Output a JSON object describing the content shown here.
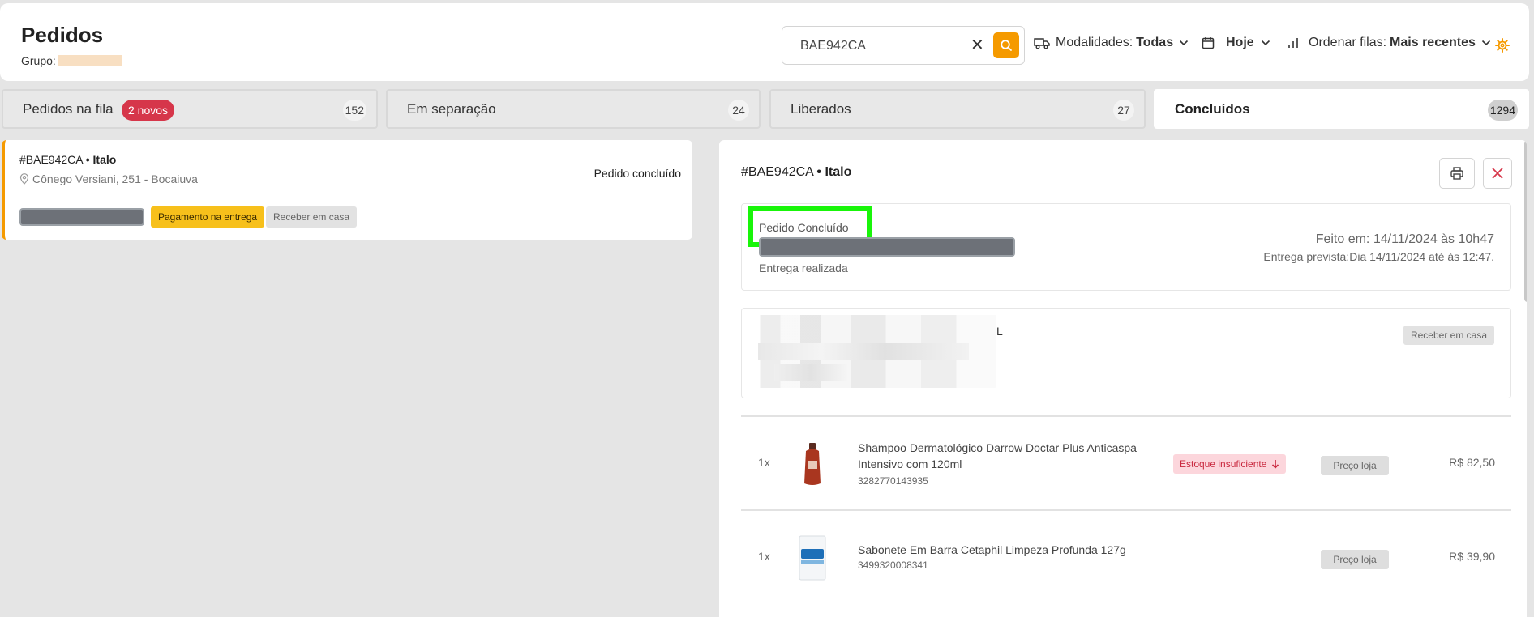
{
  "header": {
    "title": "Pedidos",
    "group_label": "Grupo:",
    "search": {
      "value": "BAE942CA",
      "placeholder": ""
    },
    "filters": {
      "modalidades_label": "Modalidades:",
      "modalidades_value": "Todas",
      "date_value": "Hoje",
      "ordenar_label": "Ordenar filas:",
      "ordenar_value": "Mais recentes"
    }
  },
  "tabs": [
    {
      "label": "Pedidos na fila",
      "badge": "2 novos",
      "count": "152",
      "active": false
    },
    {
      "label": "Em separação",
      "count": "24",
      "active": false
    },
    {
      "label": "Liberados",
      "count": "27",
      "active": false
    },
    {
      "label": "Concluídos",
      "count": "1294",
      "active": true
    }
  ],
  "order_card": {
    "id": "#BAE942CA",
    "customer": "Italo",
    "address": "Cônego Versiani, 251 - Bocaiuva",
    "status": "Pedido concluído",
    "chips": {
      "payment": "Pagamento na entrega",
      "delivery": "Receber em casa"
    }
  },
  "detail": {
    "id": "#BAE942CA",
    "customer": "Italo",
    "status_label": "Pedido Concluído",
    "status_sub": "Entrega realizada",
    "made_at": "Feito em: 14/11/2024 às 10h47",
    "expected": "Entrega prevista:Dia 14/11/2024 até às 12:47.",
    "customer_char": "L",
    "delivery_chip": "Receber em casa",
    "products": [
      {
        "qty": "1x",
        "name": "Shampoo Dermatológico Darrow Doctar Plus Anticaspa Intensivo com 120ml",
        "code": "3282770143935",
        "stock": "Estoque insuficiente",
        "price_tag": "Preço loja",
        "price": "R$ 82,50"
      },
      {
        "qty": "1x",
        "name": "Sabonete Em Barra Cetaphil Limpeza Profunda 127g",
        "code": "3499320008341",
        "price_tag": "Preço loja",
        "price": "R$ 39,90"
      }
    ]
  },
  "colors": {
    "accent": "#f59a00",
    "badge_red": "#d6364a",
    "highlight_green": "#19f50a",
    "payment_chip": "#f7c01b",
    "stock_chip_bg": "#fcd6dc"
  }
}
